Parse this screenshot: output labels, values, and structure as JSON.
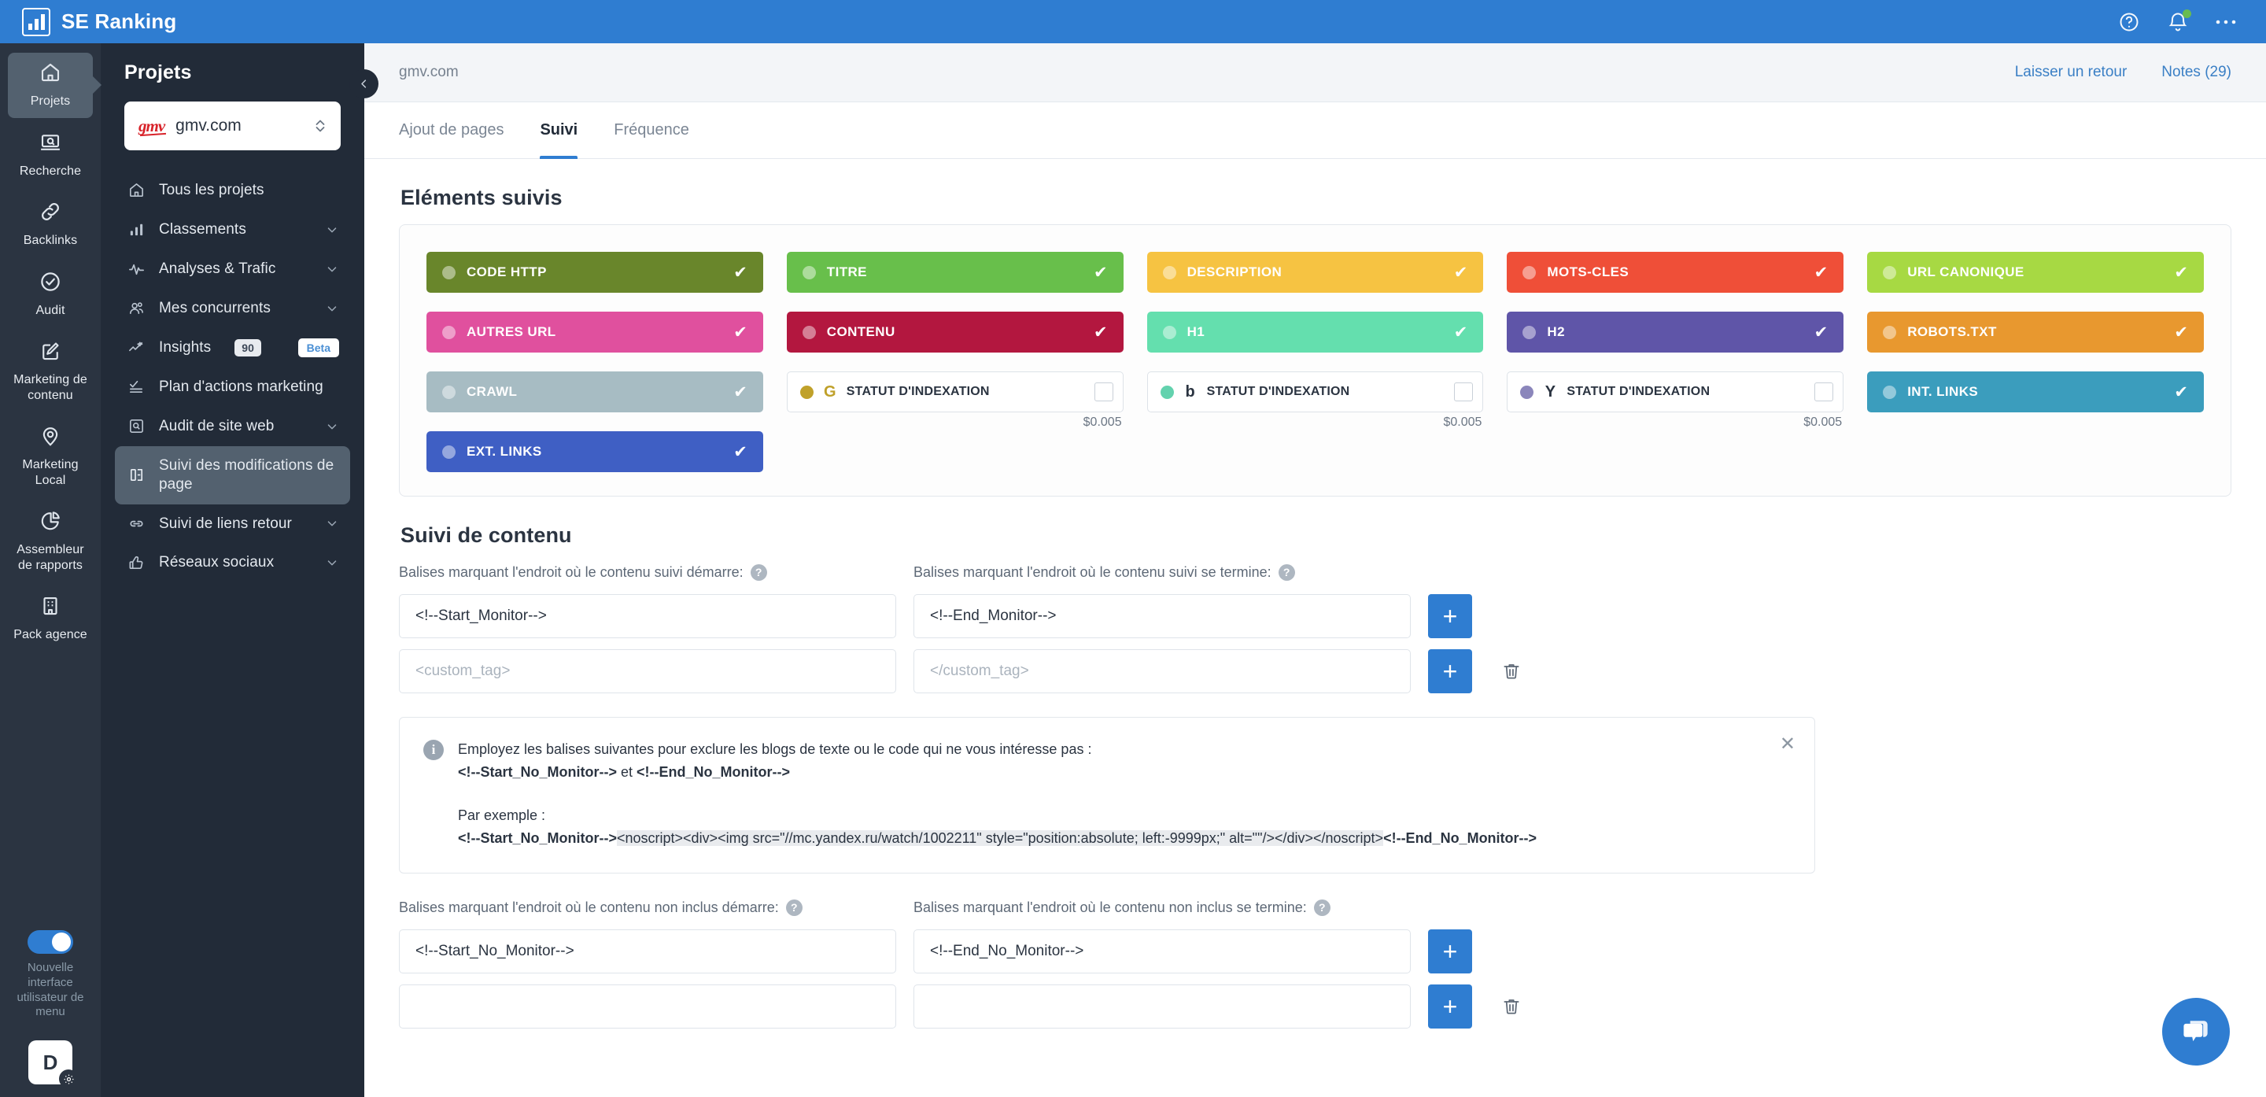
{
  "topbar": {
    "brand": "SE Ranking",
    "icons": [
      "help-icon",
      "notifications-bell-icon",
      "more-menu-icon"
    ]
  },
  "rail": {
    "items": [
      {
        "label": "Projets",
        "icon": "home-icon",
        "active": true
      },
      {
        "label": "Recherche",
        "icon": "search-laptop-icon",
        "active": false
      },
      {
        "label": "Backlinks",
        "icon": "link-icon",
        "active": false
      },
      {
        "label": "Audit",
        "icon": "check-circle-icon",
        "active": false
      },
      {
        "label": "Marketing de contenu",
        "icon": "pencil-square-icon",
        "active": false
      },
      {
        "label": "Marketing Local",
        "icon": "map-pin-icon",
        "active": false
      },
      {
        "label": "Assembleur de rapports",
        "icon": "pie-chart-icon",
        "active": false
      },
      {
        "label": "Pack agence",
        "icon": "building-icon",
        "active": false
      }
    ],
    "ui_toggle_label": "Nouvelle interface utilisateur de menu",
    "avatar_initial": "D"
  },
  "sidebar": {
    "title": "Projets",
    "project": {
      "name": "gmv.com",
      "logo_text": "gmv"
    },
    "items": [
      {
        "label": "Tous les projets",
        "icon": "home-icon",
        "chevron": false,
        "active": false
      },
      {
        "label": "Classements",
        "icon": "bar-chart-icon",
        "chevron": true,
        "active": false
      },
      {
        "label": "Analyses & Trafic",
        "icon": "pulse-icon",
        "chevron": true,
        "active": false
      },
      {
        "label": "Mes concurrents",
        "icon": "users-icon",
        "chevron": true,
        "active": false
      },
      {
        "label": "Insights",
        "icon": "sparkline-icon",
        "chevron": false,
        "active": false,
        "count": "90",
        "badge": "Beta"
      },
      {
        "label": "Plan d'actions marketing",
        "icon": "checklist-icon",
        "chevron": false,
        "active": false
      },
      {
        "label": "Audit de site web",
        "icon": "magnifier-box-icon",
        "chevron": true,
        "active": false
      },
      {
        "label": "Suivi des modifications de page",
        "icon": "page-compare-icon",
        "chevron": false,
        "active": true
      },
      {
        "label": "Suivi de liens retour",
        "icon": "chain-icon",
        "chevron": true,
        "active": false
      },
      {
        "label": "Réseaux sociaux",
        "icon": "thumbs-up-icon",
        "chevron": true,
        "active": false
      }
    ]
  },
  "subheader": {
    "breadcrumb": "gmv.com",
    "feedback_link": "Laisser un retour",
    "notes_link": "Notes (29)"
  },
  "tabs": [
    {
      "label": "Ajout de pages",
      "active": false
    },
    {
      "label": "Suivi",
      "active": true
    },
    {
      "label": "Fréquence",
      "active": false
    }
  ],
  "tracked": {
    "title": "Eléments suivis",
    "chips": [
      {
        "label": "CODE HTTP",
        "color": "#69862b",
        "type": "solid",
        "checked": true
      },
      {
        "label": "TITRE",
        "color": "#68bf4b",
        "type": "solid",
        "checked": true
      },
      {
        "label": "DESCRIPTION",
        "color": "#f6c council",
        "type": "solid",
        "checked": true
      },
      {
        "label": "MOTS-CLES",
        "color": "#ef4f38",
        "type": "solid",
        "checked": true
      },
      {
        "label": "URL CANONIQUE",
        "color": "#a7d943",
        "type": "solid",
        "checked": true
      },
      {
        "label": "AUTRES URL",
        "color": "#e0509e",
        "type": "solid",
        "checked": true
      },
      {
        "label": "CONTENU",
        "color": "#b3173f",
        "type": "solid",
        "checked": true
      },
      {
        "label": "H1",
        "color": "#64dfae",
        "type": "solid",
        "checked": true
      },
      {
        "label": "H2",
        "color": "#5f55a8",
        "type": "solid",
        "checked": true
      },
      {
        "label": "ROBOTS.TXT",
        "color": "#e8982f",
        "type": "solid",
        "checked": true
      },
      {
        "label": "CRAWL",
        "color": "#a7bcc3",
        "type": "solid",
        "checked": true
      },
      {
        "label": "STATUT D'INDEXATION",
        "engine": "G",
        "engine_color": "#bfa029",
        "dot_color": "#c0a12a",
        "type": "outline",
        "checked": false,
        "price": "$0.005"
      },
      {
        "label": "STATUT D'INDEXATION",
        "engine": "b",
        "engine_color": "#2b3441",
        "dot_color": "#63d2ae",
        "type": "outline",
        "checked": false,
        "price": "$0.005"
      },
      {
        "label": "STATUT D'INDEXATION",
        "engine": "Y",
        "engine_color": "#2b3441",
        "dot_color": "#8b86bb",
        "type": "outline",
        "checked": false,
        "price": "$0.005"
      },
      {
        "label": "INT. LINKS",
        "color": "#3b9dbd",
        "type": "solid",
        "checked": true
      },
      {
        "label": "EXT. LINKS",
        "color": "#3f5fc4",
        "type": "solid",
        "checked": true
      }
    ]
  },
  "content_tracking": {
    "title": "Suivi de contenu",
    "start_label": "Balises marquant l'endroit où le contenu suivi démarre:",
    "end_label": "Balises marquant l'endroit où le contenu suivi se termine:",
    "rows": [
      {
        "start_value": "<!--Start_Monitor-->",
        "end_value": "<!--End_Monitor-->",
        "start_placeholder": "",
        "end_placeholder": "",
        "has_delete": false
      },
      {
        "start_value": "",
        "end_value": "",
        "start_placeholder": "<custom_tag>",
        "end_placeholder": "</custom_tag>",
        "has_delete": true
      }
    ],
    "add_label": "+",
    "delete_label": "trash-icon"
  },
  "notice": {
    "line1": "Employez les balises suivantes pour exclure les blogs de texte ou le code qui ne vous intéresse pas :",
    "tag_start": "<!--Start_No_Monitor-->",
    "conjunction": " et ",
    "tag_end": "<!--End_No_Monitor-->",
    "example_label": "Par exemple :",
    "example_code": "<noscript><div><img src=\"//mc.yandex.ru/watch/1002211\" style=\"position:absolute; left:-9999px;\" alt=\"\"/></div></noscript>",
    "close_label": "✕"
  },
  "excluded_tracking": {
    "start_label": "Balises marquant l'endroit où le contenu non inclus démarre:",
    "end_label": "Balises marquant l'endroit où le contenu non inclus se termine:",
    "rows": [
      {
        "start_value": "<!--Start_No_Monitor-->",
        "end_value": "<!--End_No_Monitor-->",
        "has_delete": false
      }
    ],
    "add_label": "+"
  },
  "chat": {
    "icon": "chat-bubble-icon"
  }
}
